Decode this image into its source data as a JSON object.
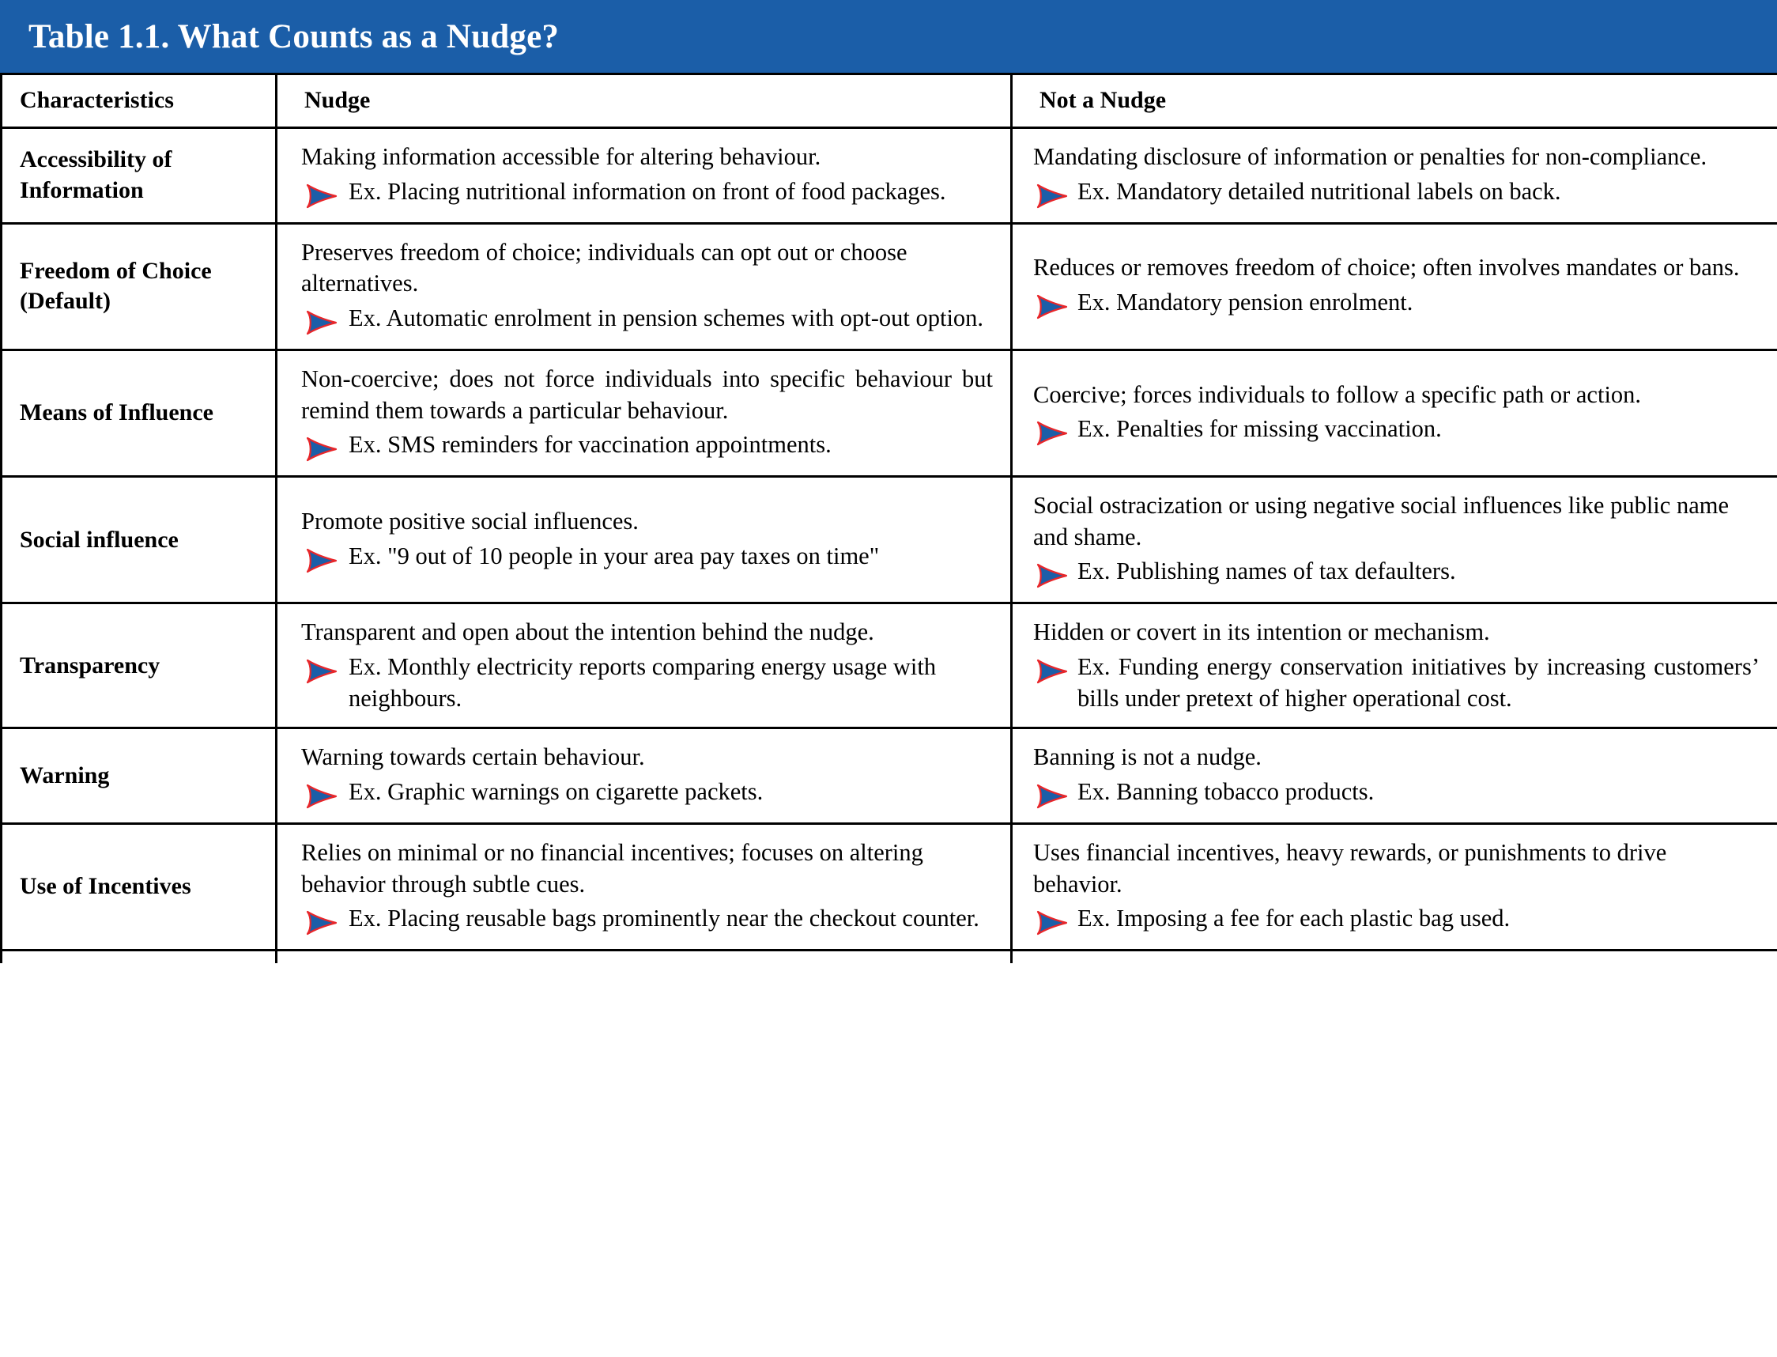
{
  "table": {
    "title": "Table 1.1. What Counts as a Nudge?",
    "title_color": "#1b5ea8",
    "bullet_icon": "arrow-right-icon",
    "bullet_fill_color": "#1b5ea8",
    "bullet_stroke_color": "#e8262a",
    "columns": [
      "Characteristics",
      "Nudge",
      "Not a Nudge"
    ],
    "rows": [
      {
        "characteristic": "Accessibility of Information",
        "nudge": {
          "lead": "Making information accessible for altering behaviour.",
          "example": "Ex. Placing nutritional information on front of food packages."
        },
        "not_a_nudge": {
          "lead": "Mandating disclosure of information or penalties for non-compliance.",
          "example": "Ex. Mandatory detailed nutritional labels on back."
        }
      },
      {
        "characteristic": "Freedom of Choice (Default)",
        "nudge": {
          "lead": "Preserves freedom of choice; individuals can opt out or choose alternatives.",
          "example": "Ex. Automatic enrolment in pension schemes with opt-out option."
        },
        "not_a_nudge": {
          "lead": "Reduces or removes freedom of choice; often involves mandates or bans.",
          "example": "Ex. Mandatory pension enrolment."
        }
      },
      {
        "characteristic": "Means of Influence",
        "nudge": {
          "lead": "Non-coercive; does not force individuals into specific behaviour but remind them towards a particular behaviour.",
          "example": "Ex. SMS reminders for vaccination appointments."
        },
        "not_a_nudge": {
          "lead": "Coercive; forces individuals to follow a specific path or action.",
          "example": "Ex. Penalties for missing vaccination."
        }
      },
      {
        "characteristic": "Social influence",
        "nudge": {
          "lead": "Promote positive social influences.",
          "example": "Ex. \"9 out of 10 people in your area pay taxes on time\""
        },
        "not_a_nudge": {
          "lead": "Social ostracization or using negative social influences like public name and shame.",
          "example": "Ex. Publishing names of tax defaulters."
        }
      },
      {
        "characteristic": "Transparency",
        "nudge": {
          "lead": "Transparent and open about the intention behind the nudge.",
          "example": "Ex. Monthly electricity reports comparing energy usage with neighbours."
        },
        "not_a_nudge": {
          "lead": "Hidden or covert in its intention or mechanism.",
          "example": "Ex. Funding energy conservation initiatives by increasing customers’ bills under pretext of higher operational cost."
        }
      },
      {
        "characteristic": "Warning",
        "nudge": {
          "lead": "Warning towards certain behaviour.",
          "example": "Ex. Graphic warnings on cigarette packets."
        },
        "not_a_nudge": {
          "lead": "Banning is not a nudge.",
          "example": "Ex. Banning tobacco products."
        }
      },
      {
        "characteristic": "Use of Incentives",
        "nudge": {
          "lead": "Relies on minimal or no financial incentives; focuses on altering behavior through subtle cues.",
          "example": "Ex. Placing reusable bags prominently near the checkout counter."
        },
        "not_a_nudge": {
          "lead": "Uses financial incentives, heavy rewards, or punishments to drive behavior.",
          "example": "Ex. Imposing a fee for each plastic bag used."
        }
      }
    ]
  }
}
